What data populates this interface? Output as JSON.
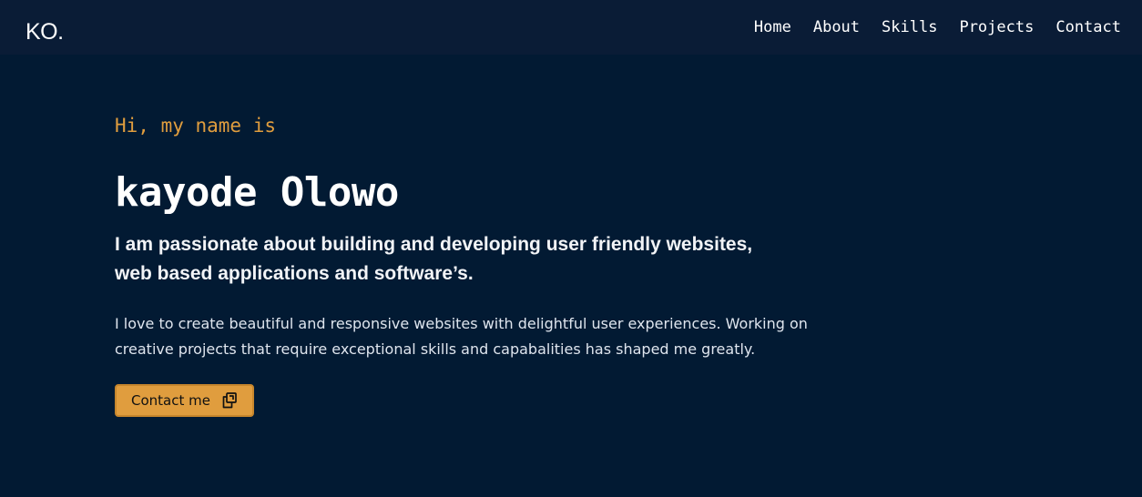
{
  "header": {
    "logo": "KO.",
    "nav": [
      {
        "label": "Home"
      },
      {
        "label": "About"
      },
      {
        "label": "Skills"
      },
      {
        "label": "Projects"
      },
      {
        "label": "Contact"
      }
    ]
  },
  "hero": {
    "greeting": "Hi, my name is",
    "name": "kayode Olowo",
    "tagline": "I am passionate about building and developing user friendly websites, web based applications and software’s.",
    "bio": "I love to create beautiful and responsive websites with delightful user experiences. Working on creative projects that require exceptional skills and capabalities has shaped me greatly.",
    "cta": {
      "label": "Contact me",
      "icon": "copy-icon"
    }
  },
  "colors": {
    "background": "#021a33",
    "navbar": "#0a1c36",
    "accent": "#e09d3e",
    "text": "#ffffff"
  }
}
